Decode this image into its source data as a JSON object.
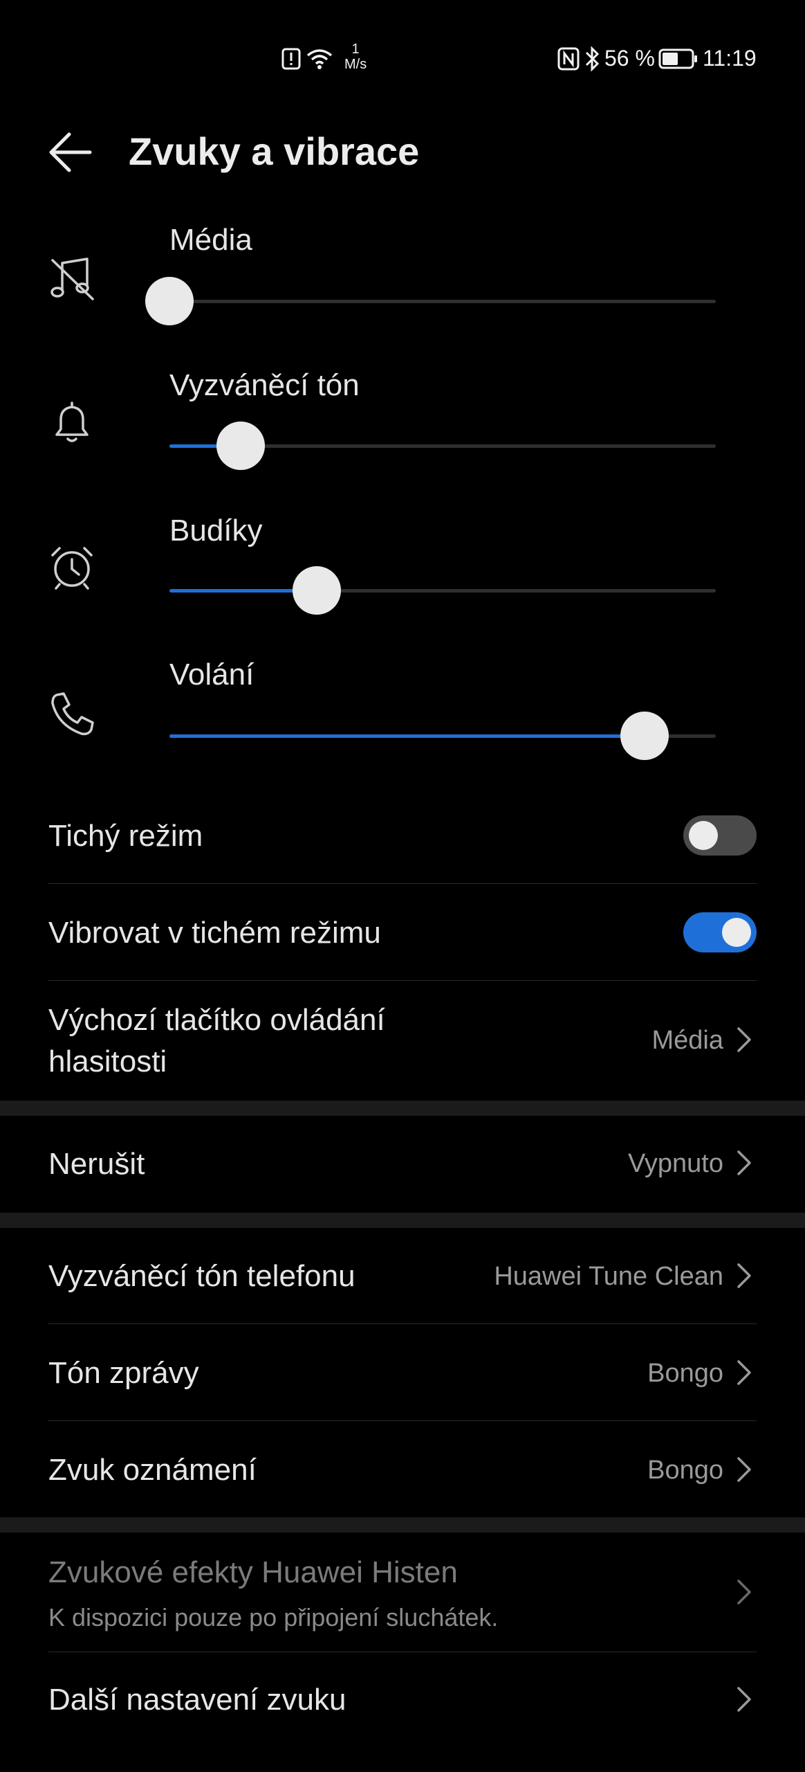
{
  "status_bar": {
    "net_speed_value": "1",
    "net_speed_unit": "M/s",
    "battery_percent": "56 %",
    "time": "11:19",
    "icons": [
      "alert-icon",
      "wifi-icon",
      "nfc-icon",
      "bluetooth-icon",
      "battery-icon"
    ]
  },
  "header": {
    "title": "Zvuky a vibrace"
  },
  "volumes": [
    {
      "label": "Média",
      "icon": "music-muted-icon",
      "level": 0.0
    },
    {
      "label": "Vyzváněcí tón",
      "icon": "bell-icon",
      "level": 0.13
    },
    {
      "label": "Budíky",
      "icon": "alarm-clock-icon",
      "level": 0.27
    },
    {
      "label": "Volání",
      "icon": "phone-icon",
      "level": 0.87
    }
  ],
  "toggles": [
    {
      "label": "Tichý režim",
      "on": false
    },
    {
      "label": "Vibrovat v tichém režimu",
      "on": true
    }
  ],
  "default_volume": {
    "label_line1": "Výchozí tlačítko ovládání",
    "label_line2": "hlasitosti",
    "value": "Média"
  },
  "dnd": {
    "label": "Nerušit",
    "value": "Vypnuto"
  },
  "tones": [
    {
      "label": "Vyzváněcí tón telefonu",
      "value": "Huawei Tune Clean"
    },
    {
      "label": "Tón zprávy",
      "value": "Bongo"
    },
    {
      "label": "Zvuk oznámení",
      "value": "Bongo"
    }
  ],
  "histen": {
    "label": "Zvukové efekty Huawei Histen",
    "sublabel": "K dispozici pouze po připojení sluchátek."
  },
  "more": {
    "label": "Další nastavení zvuku"
  },
  "colors": {
    "accent": "#1f6fd9",
    "background": "#000000",
    "separator_band": "#1b1b1b"
  }
}
